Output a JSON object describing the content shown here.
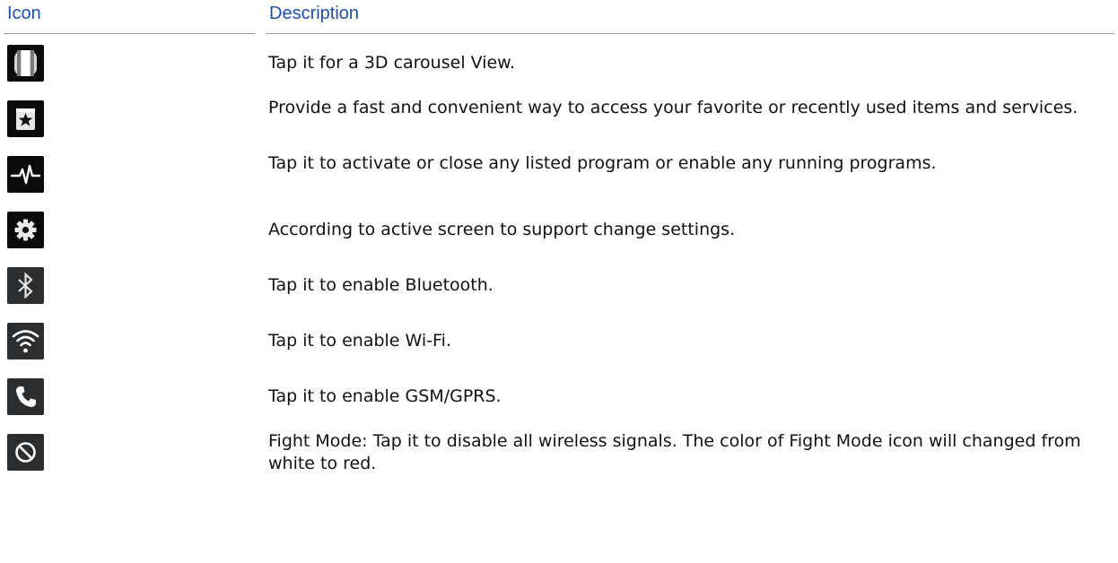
{
  "header": {
    "icon_col": "Icon",
    "desc_col": "Description"
  },
  "rows": [
    {
      "icon": "carousel-view-icon",
      "description": "Tap it for a 3D carousel View."
    },
    {
      "icon": "favorites-star-icon",
      "description": "Provide a fast and convenient way to access your favorite or recently used items and services."
    },
    {
      "icon": "task-manager-pulse-icon",
      "description": "Tap it to activate or close any listed program or enable any running programs."
    },
    {
      "icon": "settings-gear-icon",
      "description": "According to active screen to support change settings."
    },
    {
      "icon": "bluetooth-icon",
      "description": "Tap it to enable Bluetooth."
    },
    {
      "icon": "wifi-icon",
      "description": "Tap it to enable Wi-Fi."
    },
    {
      "icon": "phone-icon",
      "description": "Tap it to enable GSM/GPRS."
    },
    {
      "icon": "flight-mode-icon",
      "description": "Fight Mode: Tap it to disable all wireless signals. The color of Fight Mode icon will changed from white to red."
    }
  ],
  "colors": {
    "header_text": "#1f4fa8",
    "header_rule": "#9a9a9a",
    "icon_bg_dark": "#0b0b0b",
    "icon_bg_grey": "#2b2e31"
  }
}
